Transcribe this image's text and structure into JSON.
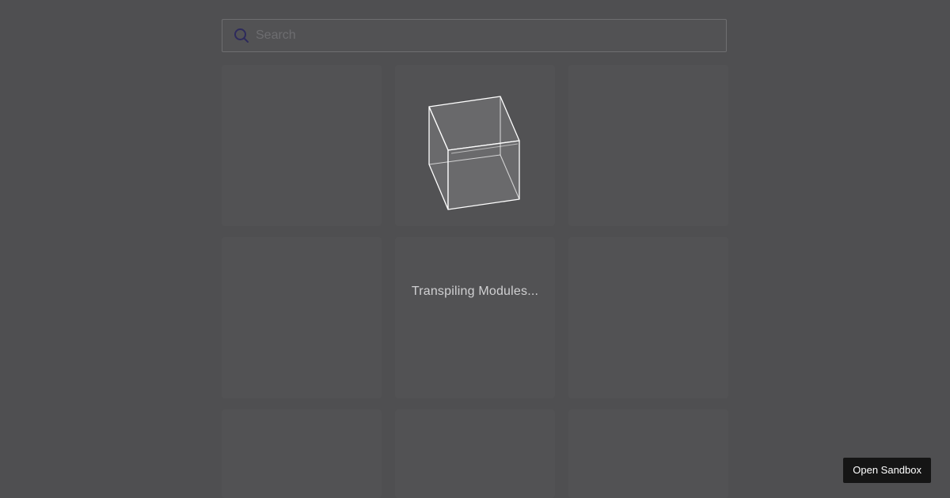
{
  "search": {
    "placeholder": "Search",
    "icon": "search-icon"
  },
  "status": {
    "message": "Transpiling Modules..."
  },
  "actions": {
    "open_sandbox_label": "Open Sandbox"
  },
  "colors": {
    "background": "#4f4f51",
    "tile": "#525254",
    "search_icon": "#2d2a5c",
    "button_bg": "#151515",
    "button_text": "#ffffff",
    "status_text": "#d0d0d2"
  }
}
